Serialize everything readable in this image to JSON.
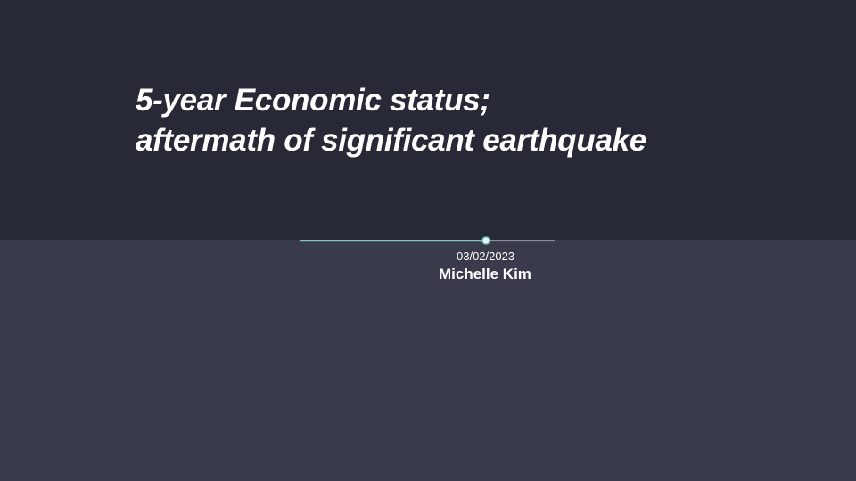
{
  "slide": {
    "title_line1": "5-year Economic status;",
    "title_line2": "aftermath of significant earthquake",
    "date": "03/02/2023",
    "author": "Michelle Kim"
  },
  "colors": {
    "top_band": "#272936",
    "bottom_band": "#393b4d",
    "text": "#ffffff",
    "accent_line": "#7ec8c3",
    "muted_line": "#8a8d99"
  }
}
